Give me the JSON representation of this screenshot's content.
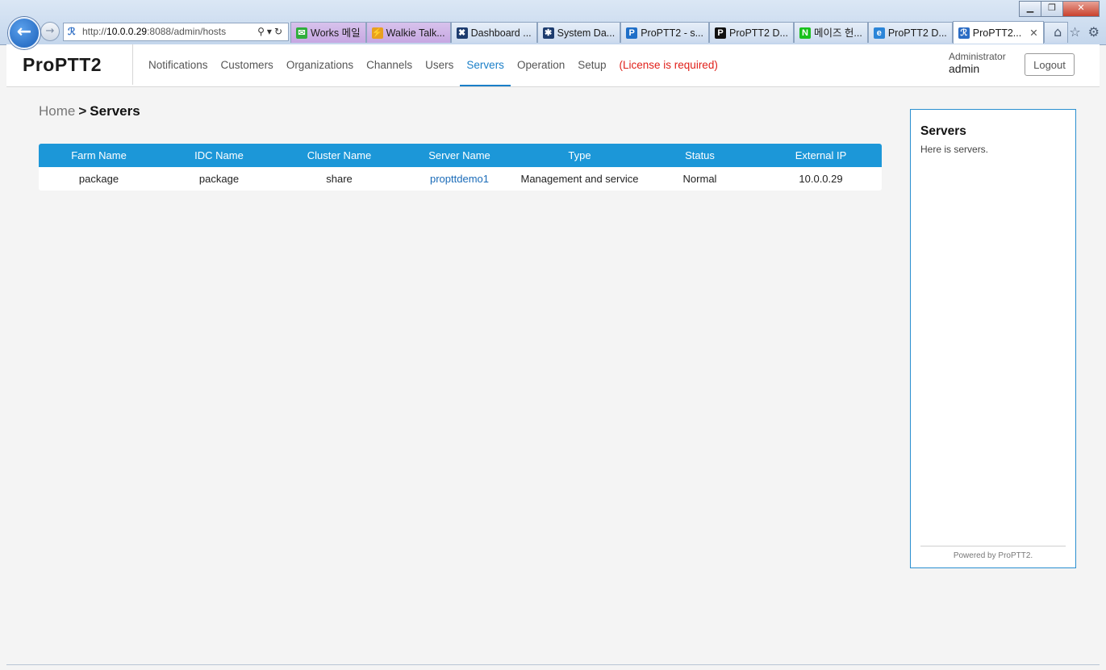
{
  "browser": {
    "url_prefix": "http://",
    "url_host": "10.0.0.29",
    "url_rest": ":8088/admin/hosts",
    "tabs": [
      {
        "label": "Works 메일",
        "icon": "mail-icon",
        "color": "#2fae3c",
        "style": "purple"
      },
      {
        "label": "Walkie Talk...",
        "icon": "walkie-talkie-icon",
        "color": "#e8a020",
        "style": "purple"
      },
      {
        "label": "Dashboard ...",
        "icon": "tools-icon",
        "color": "#1d3c6e",
        "style": "normal"
      },
      {
        "label": "System Da...",
        "icon": "system-icon",
        "color": "#1d3c6e",
        "style": "normal"
      },
      {
        "label": "ProPTT2 - s...",
        "icon": "p-icon",
        "color": "#1f6fc8",
        "style": "normal"
      },
      {
        "label": "ProPTT2 D...",
        "icon": "p-dark-icon",
        "color": "#111111",
        "style": "normal"
      },
      {
        "label": "메이즈 헌...",
        "icon": "naver-icon",
        "color": "#19c11c",
        "style": "normal"
      },
      {
        "label": "ProPTT2 D...",
        "icon": "ie-icon",
        "color": "#2b85d8",
        "style": "normal"
      },
      {
        "label": "ProPTT2...",
        "icon": "proptt-icon",
        "color": "#2b6cc4",
        "style": "active"
      }
    ]
  },
  "app": {
    "logo": "ProPTT2",
    "nav": [
      {
        "label": "Notifications",
        "state": "normal"
      },
      {
        "label": "Customers",
        "state": "normal"
      },
      {
        "label": "Organizations",
        "state": "normal"
      },
      {
        "label": "Channels",
        "state": "normal"
      },
      {
        "label": "Users",
        "state": "normal"
      },
      {
        "label": "Servers",
        "state": "active"
      },
      {
        "label": "Operation",
        "state": "normal"
      },
      {
        "label": "Setup",
        "state": "normal"
      },
      {
        "label": "(License is required)",
        "state": "warn"
      }
    ],
    "user_role": "Administrator",
    "user_name": "admin",
    "logout_label": "Logout",
    "accent_color": "#1c97d8",
    "warn_color": "#e0201a"
  },
  "breadcrumb": {
    "home": "Home",
    "separator": ">",
    "current": "Servers"
  },
  "servers_table": {
    "columns": [
      "Farm Name",
      "IDC Name",
      "Cluster Name",
      "Server Name",
      "Type",
      "Status",
      "External IP"
    ],
    "rows": [
      [
        "package",
        "package",
        "share",
        "propttdemo1",
        "Management and service",
        "Normal",
        "10.0.0.29"
      ]
    ]
  },
  "side_panel": {
    "title": "Servers",
    "description": "Here is servers.",
    "footer": "Powered by ProPTT2."
  }
}
